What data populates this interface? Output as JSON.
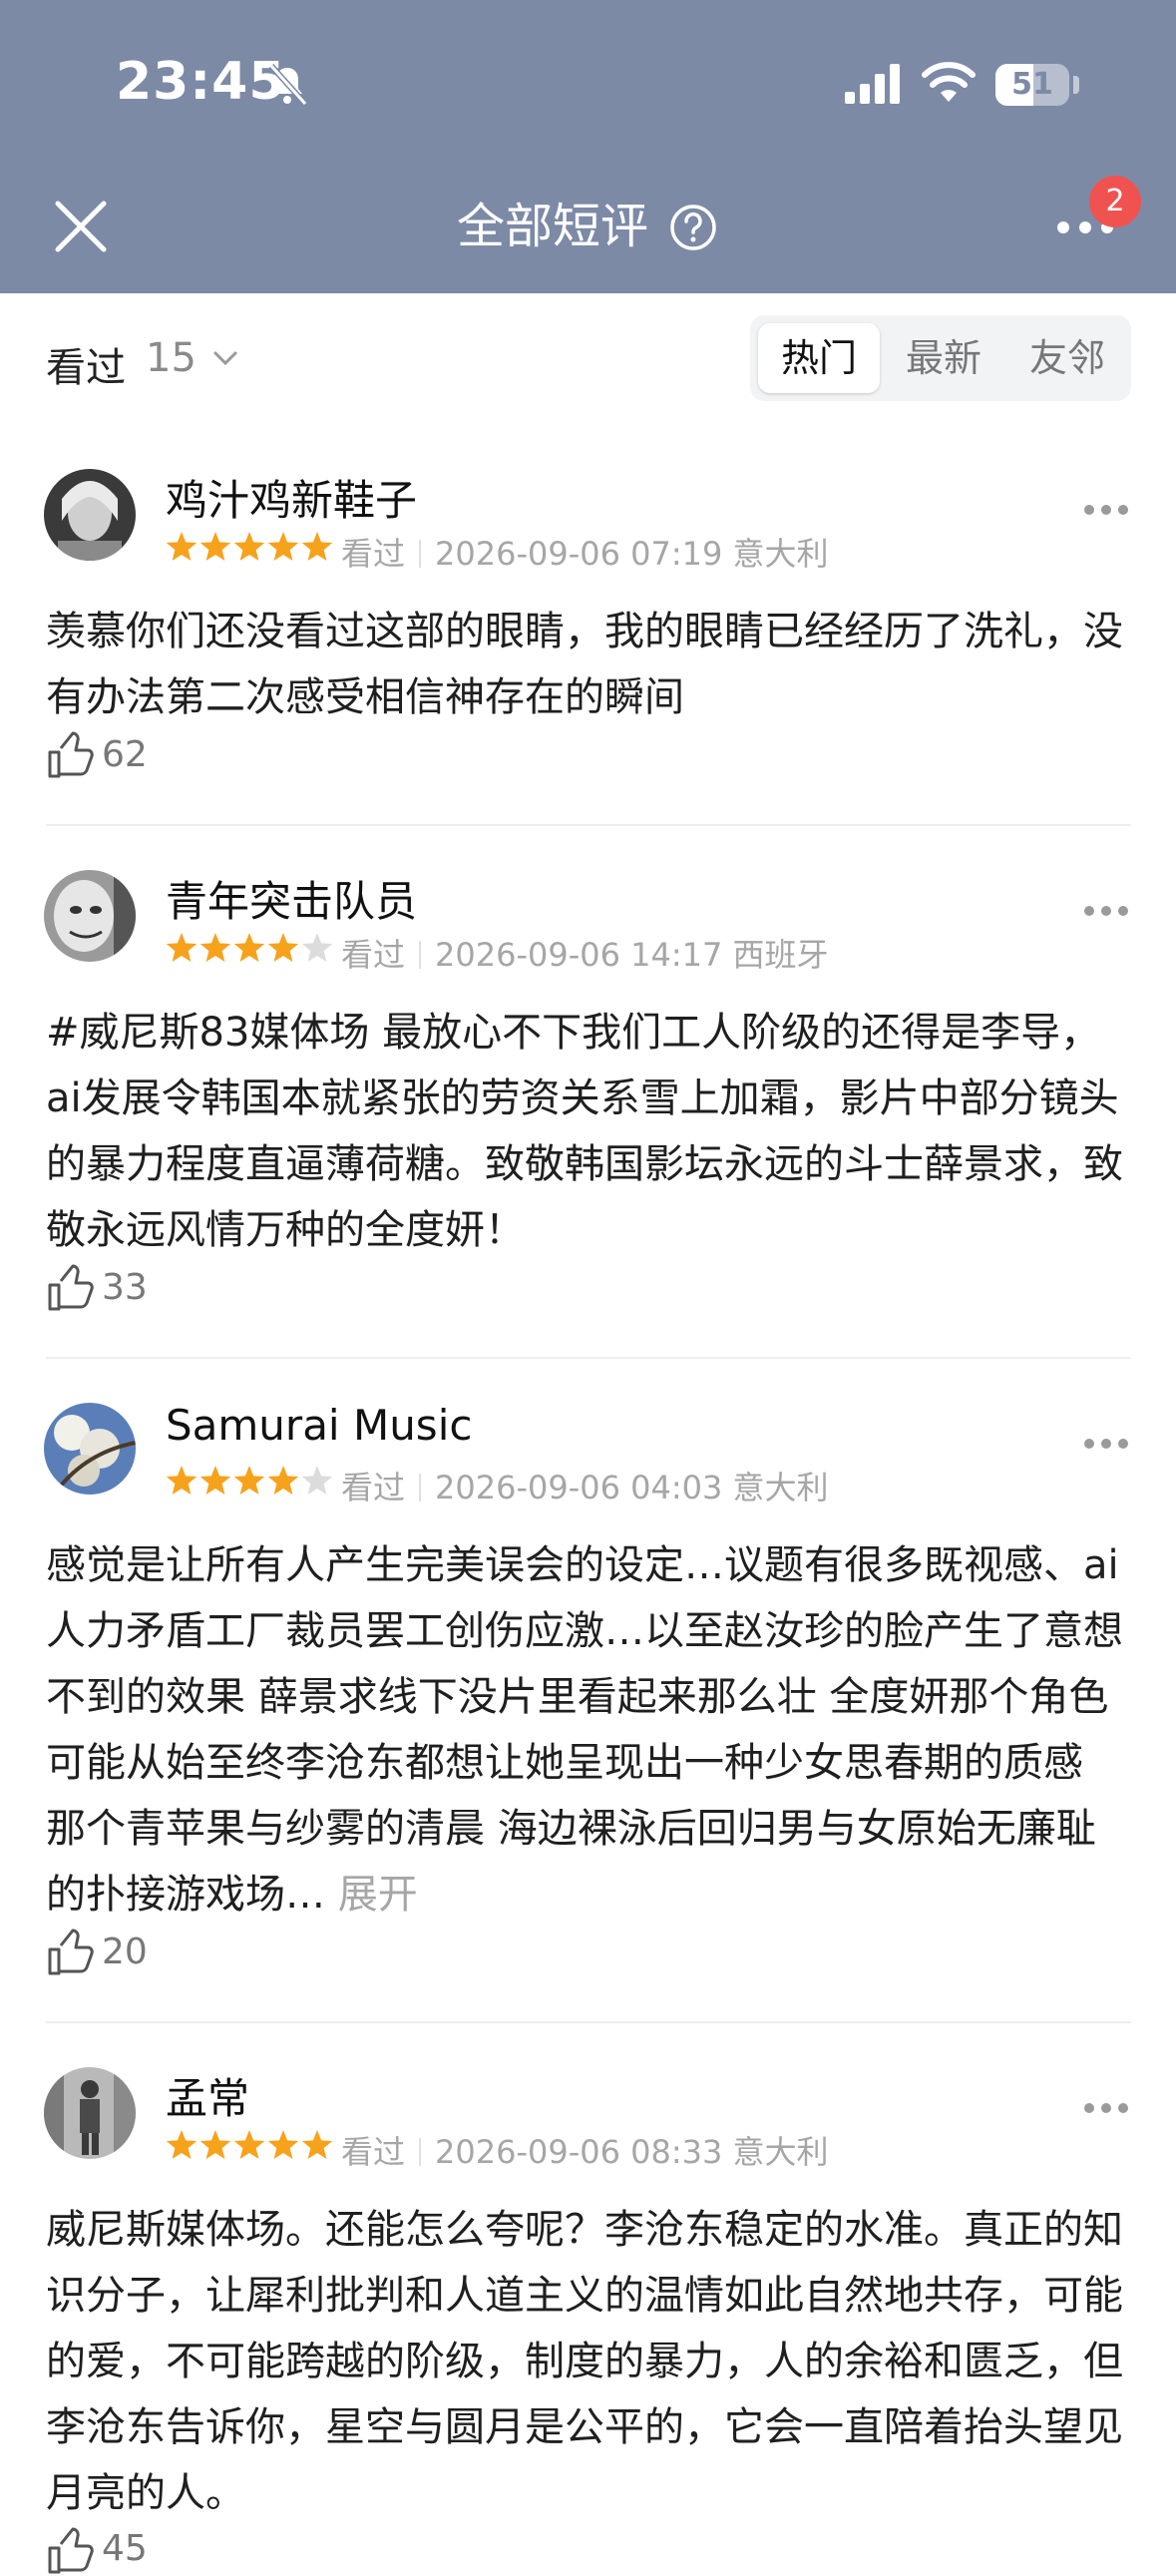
{
  "status_bar": {
    "time": "23:45",
    "battery": "51",
    "battery_level": 0.51
  },
  "nav": {
    "title": "全部短评",
    "notification_count": "2",
    "color": "#7d8aa6"
  },
  "filter": {
    "label": "看过",
    "count": "15",
    "tabs": [
      {
        "label": "热门",
        "active": true
      },
      {
        "label": "最新",
        "active": false
      },
      {
        "label": "友邻",
        "active": false
      }
    ]
  },
  "reviews": [
    {
      "user": "鸡汁鸡新鞋子",
      "rating": 5,
      "status": "看过",
      "time": "2026-09-06 07:19",
      "location": "意大利",
      "text": "羡慕你们还没看过这部的眼睛，我的眼睛已经经历了洗礼，没有办法第二次感受相信神存在的瞬间",
      "likes": "62"
    },
    {
      "user": "青年突击队员",
      "rating": 4,
      "status": "看过",
      "time": "2026-09-06 14:17",
      "location": "西班牙",
      "text": "#威尼斯83媒体场 最放心不下我们工人阶级的还得是李导，ai发展令韩国本就紧张的劳资关系雪上加霜，影片中部分镜头的暴力程度直逼薄荷糖。致敬韩国影坛永远的斗士薛景求，致敬永远风情万种的全度妍！",
      "likes": "33"
    },
    {
      "user": "Samurai Music",
      "rating": 4,
      "status": "看过",
      "time": "2026-09-06 04:03",
      "location": "意大利",
      "text": "感觉是让所有人产生完美误会的设定…议题有很多既视感、ai人力矛盾工厂裁员罢工创伤应激…以至赵汝珍的脸产生了意想不到的效果 薛景求线下没片里看起来那么壮 全度妍那个角色 可能从始至终李沧东都想让她呈现出一种少女思春期的质感 那个青苹果与纱雾的清晨 海边裸泳后回归男与女原始无廉耻的扑接游戏场…",
      "expand": "展开",
      "likes": "20"
    },
    {
      "user": "孟常",
      "rating": 5,
      "status": "看过",
      "time": "2026-09-06 08:33",
      "location": "意大利",
      "text": "威尼斯媒体场。还能怎么夸呢？李沧东稳定的水准。真正的知识分子，让犀利批判和人道主义的温情如此自然地共存，可能的爱，不可能跨越的阶级，制度的暴力，人的余裕和匮乏，但李沧东告诉你，星空与圆月是公平的，它会一直陪着抬头望见月亮的人。",
      "likes": "45"
    }
  ],
  "colors": {
    "star": "#f7a21b",
    "star_empty": "#dcdcdc",
    "badge": "#f0534f"
  }
}
